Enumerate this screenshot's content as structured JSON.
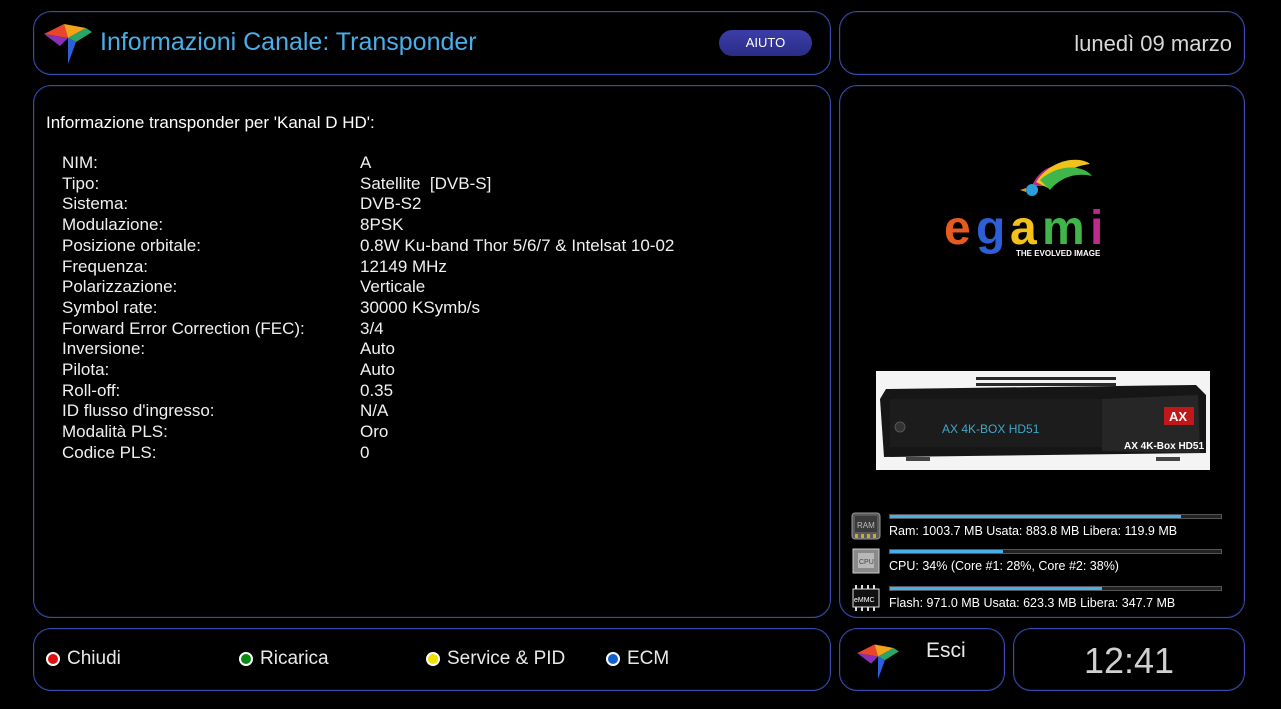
{
  "header": {
    "title": "Informazioni Canale: Transponder",
    "help_label": "AIUTO"
  },
  "date": "lunedì 09 marzo",
  "info": {
    "heading": "Informazione transponder per 'Kanal D HD':",
    "rows": [
      {
        "k": "NIM:",
        "v": "A"
      },
      {
        "k": "Tipo:",
        "v": "Satellite  [DVB-S]"
      },
      {
        "k": "Sistema:",
        "v": "DVB-S2"
      },
      {
        "k": "Modulazione:",
        "v": "8PSK"
      },
      {
        "k": "Posizione orbitale:",
        "v": "0.8W Ku-band Thor 5/6/7 & Intelsat 10-02"
      },
      {
        "k": "Frequenza:",
        "v": "12149 MHz"
      },
      {
        "k": "Polarizzazione:",
        "v": "Verticale"
      },
      {
        "k": "Symbol rate:",
        "v": "30000 KSymb/s"
      },
      {
        "k": "Forward Error Correction (FEC):",
        "v": "3/4"
      },
      {
        "k": "Inversione:",
        "v": "Auto"
      },
      {
        "k": "Pilota:",
        "v": "Auto"
      },
      {
        "k": "Roll-off:",
        "v": "0.35"
      },
      {
        "k": "ID flusso d'ingresso:",
        "v": "N/A"
      },
      {
        "k": "Modalità PLS:",
        "v": "Oro"
      },
      {
        "k": "Codice PLS:",
        "v": "0"
      }
    ]
  },
  "side": {
    "brand_text": "egami",
    "brand_tagline": "THE EVOLVED IMAGE",
    "box_model_front": "AX 4K-BOX HD51",
    "box_model_label": "AX 4K-Box HD51",
    "box_logo": "AX",
    "meters": [
      {
        "name": "ram",
        "icon_label": "RAM",
        "text": "Ram: 1003.7 MB Usata: 883.8 MB Libera: 119.9 MB",
        "fraction": 0.88
      },
      {
        "name": "cpu",
        "icon_label": "CPU",
        "text": "CPU: 34% (Core #1:  28%, Core #2:  38%)",
        "fraction": 0.34
      },
      {
        "name": "flash",
        "icon_label": "eMMC",
        "text": "Flash: 971.0 MB Usata: 623.3 MB Libera: 347.7 MB",
        "fraction": 0.64
      }
    ]
  },
  "footer": {
    "red": "Chiudi",
    "green": "Ricarica",
    "yellow": "Service & PID",
    "blue": "ECM",
    "colors": {
      "red": "#e01010",
      "green": "#0a8a12",
      "yellow": "#f0e000",
      "blue": "#1060d0"
    }
  },
  "exit_label": "Esci",
  "clock": "12:41"
}
